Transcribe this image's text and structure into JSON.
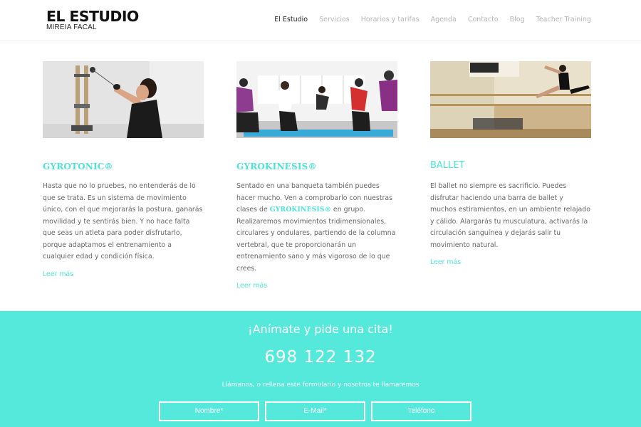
{
  "header": {
    "logo_title": "EL ESTUDIO",
    "logo_subtitle": "MIREIA FACAL",
    "nav": [
      "El Estudio",
      "Servicios",
      "Horarios y tarifas",
      "Agenda",
      "Contacto",
      "Blog",
      "Teacher Training"
    ],
    "nav_active_index": 0
  },
  "columns": [
    {
      "title": "GYROTONIC®",
      "text": "Hasta que no lo pruebes, no entenderás de lo que se trata. Es un sistema de movimiento único, con el que mejorarás la postura, ganarás movilidad y te sentirás bien. Y no hace falta que seas un atleta para poder disfrutarlo, porque adaptamos el entrenamiento a cualquier edad y condición física.",
      "link": "Leer más"
    },
    {
      "title": "GYROKINESIS®",
      "text_before": "Sentado en una banqueta también puedes hacer mucho. Ven a comprobarlo con nuestras clases de ",
      "text_highlight": "GYROKINESIS®",
      "text_after": " en grupo. Realizaremos movimientos tridimensionales, circulares y ondulares, partiendo de la columna vertebral, que te proporcionarán un entrenamiento sano y más vigoroso de lo que crees.",
      "link": "Leer más"
    },
    {
      "title": "BALLET",
      "text": "El ballet no siempre es sacrificio. Puedes disfrutar haciendo una barra de ballet y muchos estiramientos, en un ambiente relajado y cálido. Alargarás tu musculatura, activarás la circulación sanguínea y dejarás salir tu movimiento natural.",
      "link": "Leer más"
    }
  ],
  "cta": {
    "title": "¡Anímate y pide una cita!",
    "phone": "698 122 132",
    "text": "Llámanos, o rellena este formulario y nosotros te llamaremos",
    "fields": {
      "name_placeholder": "Nombre*",
      "email_placeholder": "E-Mail*",
      "phone_placeholder": "Teléfono"
    }
  },
  "colors": {
    "accent": "#55e9dc",
    "heading": "#4ee3d6",
    "text": "#666666"
  }
}
